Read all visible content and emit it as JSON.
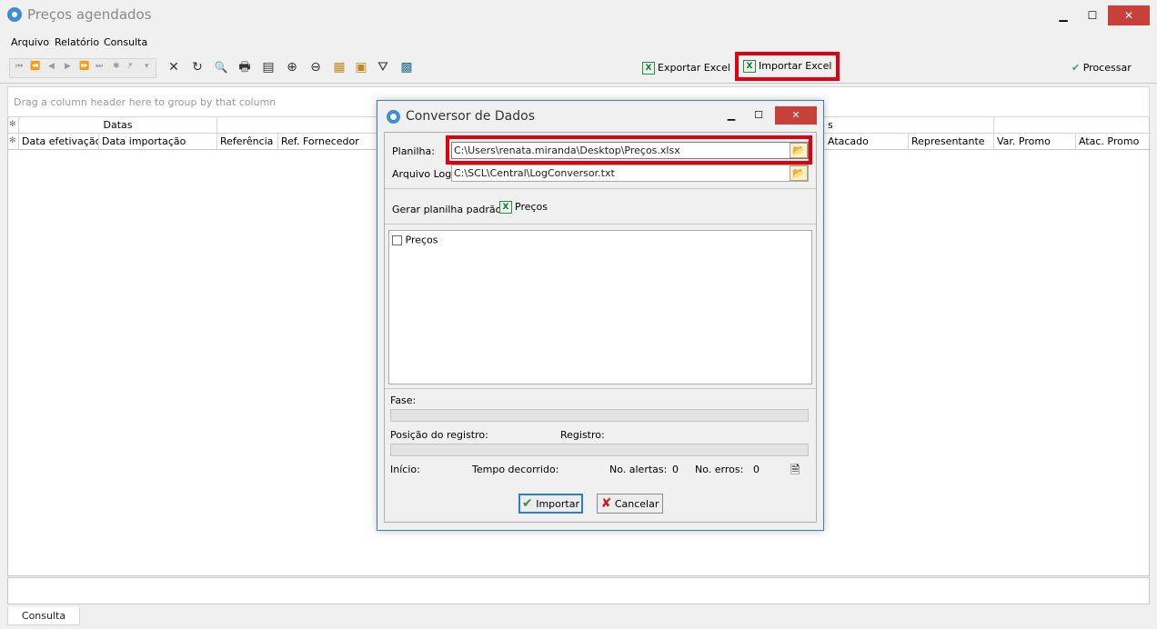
{
  "window": {
    "title": "Preços agendados",
    "minimize_glyph": "▁",
    "maximize_glyph": "☐",
    "close_glyph": "✕"
  },
  "menu": [
    "Arquivo",
    "Relatório",
    "Consulta"
  ],
  "navigator": [
    "⏮",
    "⏪",
    "◀",
    "▶",
    "⏩",
    "⏭",
    "✱",
    "*̷",
    "▾"
  ],
  "toolbar_icons": [
    {
      "name": "delete-icon",
      "glyph": "✕"
    },
    {
      "name": "refresh-icon",
      "glyph": "↻"
    },
    {
      "name": "print-preview-icon",
      "glyph": "🔍"
    },
    {
      "name": "print-icon",
      "glyph": "🖶"
    },
    {
      "name": "export-icon",
      "glyph": "▤"
    },
    {
      "name": "zoom-in-icon",
      "glyph": "⊕"
    },
    {
      "name": "zoom-out-icon",
      "glyph": "⊖"
    },
    {
      "name": "columns-icon",
      "glyph": "▦"
    },
    {
      "name": "layout-icon",
      "glyph": "▣"
    },
    {
      "name": "filter-icon",
      "glyph": "⛛"
    },
    {
      "name": "calculator-icon",
      "glyph": "▩"
    }
  ],
  "toolbar": {
    "export_excel": "Exportar Excel",
    "import_excel": "Importar Excel",
    "processar": "Processar",
    "excel_glyph": "X",
    "check_glyph": "✔",
    "highlight_color": "#e0000f"
  },
  "grid": {
    "group_hint": "Drag a column header here to group by that column",
    "band_marker": "✻",
    "band_label": "Datas",
    "band_right_fragment": "s",
    "columns_left": [
      "Data efetivação",
      "Data importação",
      "Referência",
      "Ref. Fornecedor"
    ],
    "columns_right": [
      "Atacado",
      "Representante",
      "Var. Promo",
      "Atac. Promo"
    ]
  },
  "status_tab": "Consulta",
  "dialog": {
    "title": "Conversor de Dados",
    "planilha_label": "Planilha:",
    "planilha_value": "C:\\Users\\renata.miranda\\Desktop\\Preços.xlsx",
    "arquivo_log_label": "Arquivo Log:",
    "arquivo_log_value": "C:\\SCL\\Central\\LogConversor.txt",
    "folder_glyph": "📂",
    "gerar_label": "Gerar planilha padrão:",
    "gerar_link": "Preços",
    "list_items": [
      "Preços"
    ],
    "fase_label": "Fase:",
    "posicao_label": "Posição do registro:",
    "registro_label": "Registro:",
    "inicio_label": "Início:",
    "tempo_label": "Tempo decorrido:",
    "alertas_label": "No. alertas:",
    "alertas_value": "0",
    "erros_label": "No. erros:",
    "erros_value": "0",
    "log_glyph": "🗎",
    "importar": "Importar",
    "cancelar": "Cancelar",
    "ok_glyph": "✔",
    "cancel_glyph": "✘"
  }
}
